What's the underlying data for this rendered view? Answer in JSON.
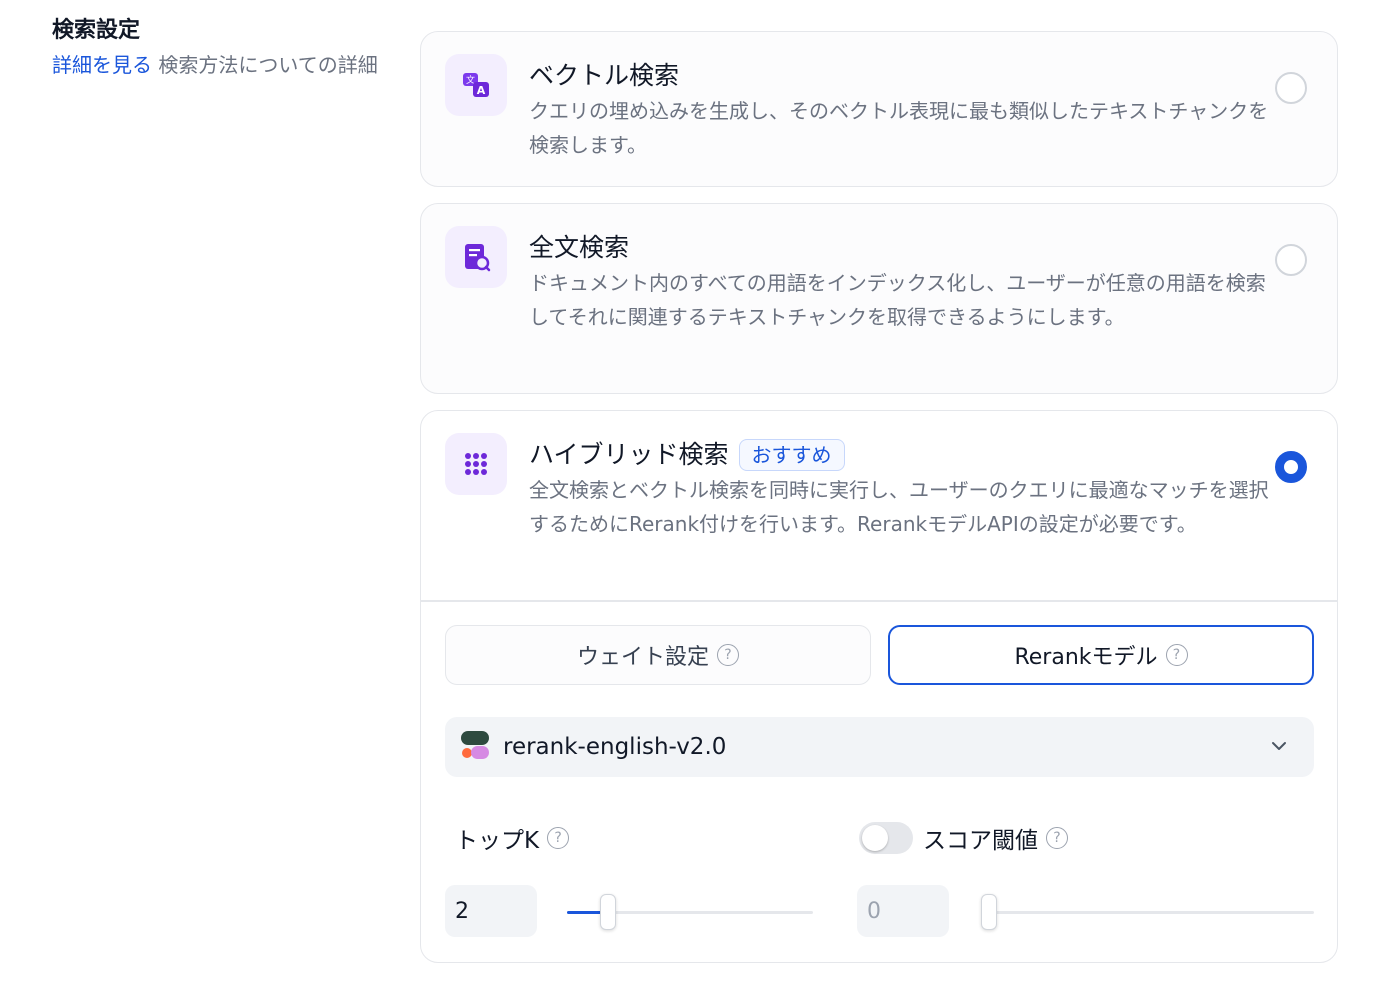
{
  "section": {
    "title": "検索設定",
    "link_text": "詳細を見る",
    "desc_text": " 検索方法についての詳細"
  },
  "methods": [
    {
      "title": "ベクトル検索",
      "description": "クエリの埋め込みを生成し、そのベクトル表現に最も類似したテキストチャンクを検索します。",
      "icon": "translate-icon",
      "selected": false
    },
    {
      "title": "全文検索",
      "description": "ドキュメント内のすべての用語をインデックス化し、ユーザーが任意の用語を検索してそれに関連するテキストチャンクを取得できるようにします。",
      "icon": "document-search-icon",
      "selected": false
    },
    {
      "title": "ハイブリッド検索",
      "badge": "おすすめ",
      "description": "全文検索とベクトル検索を同時に実行し、ユーザーのクエリに最適なマッチを選択するためにRerank付けを行います。RerankモデルAPIの設定が必要です。",
      "icon": "grid-dots-icon",
      "selected": true
    }
  ],
  "hybrid": {
    "tabs": [
      {
        "label": "ウェイト設定",
        "active": false
      },
      {
        "label": "Rerankモデル",
        "active": true
      }
    ],
    "model": {
      "name": "rerank-english-v2.0",
      "icon": "cohere-logo-icon"
    },
    "top_k": {
      "label": "トップK",
      "value": "2",
      "slider_fraction": 0.03
    },
    "score_threshold": {
      "label": "スコア閾値",
      "value": "0",
      "enabled": false,
      "slider_fraction": 0
    }
  },
  "colors": {
    "accent": "#1a56db",
    "icon_purple": "#6d28d9",
    "icon_bg": "#f3eefe"
  }
}
